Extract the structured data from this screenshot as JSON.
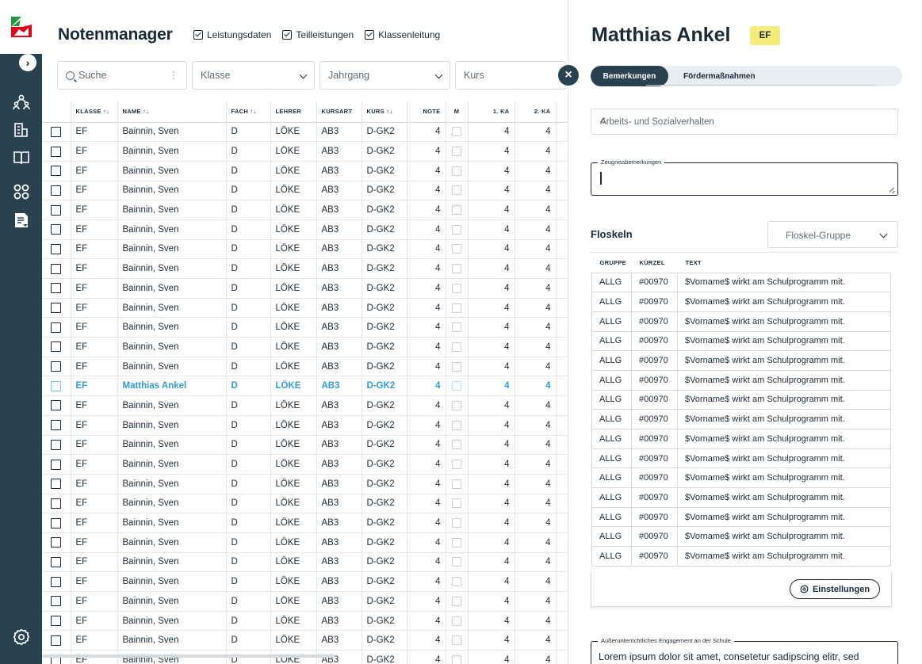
{
  "app": {
    "title": "Notenmanager"
  },
  "toggles": [
    "Leistungsdaten",
    "Teilleistungen",
    "Klassenleitung"
  ],
  "filters": {
    "search_placeholder": "Suche",
    "klasse": "Klasse",
    "jahrgang": "Jahrgang",
    "kurs": "Kurs"
  },
  "table": {
    "headers": [
      "KLASSE ↑↓",
      "NAME ↑↓",
      "FACH ↑↓",
      "LEHRER",
      "KURSART",
      "KURS ↑↓",
      "NOTE",
      "M",
      "1. KA",
      "2. KA"
    ],
    "rows": [
      [
        "EF",
        "Bainnin, Sven",
        "D",
        "LÖKE",
        "AB3",
        "D-GK2",
        "4",
        "4",
        "4"
      ],
      [
        "EF",
        "Bainnin, Sven",
        "D",
        "LÖKE",
        "AB3",
        "D-GK2",
        "4",
        "4",
        "4"
      ],
      [
        "EF",
        "Bainnin, Sven",
        "D",
        "LÖKE",
        "AB3",
        "D-GK2",
        "4",
        "4",
        "4"
      ],
      [
        "EF",
        "Bainnin, Sven",
        "D",
        "LÖKE",
        "AB3",
        "D-GK2",
        "4",
        "4",
        "4"
      ],
      [
        "EF",
        "Bainnin, Sven",
        "D",
        "LÖKE",
        "AB3",
        "D-GK2",
        "4",
        "4",
        "4"
      ],
      [
        "EF",
        "Bainnin, Sven",
        "D",
        "LÖKE",
        "AB3",
        "D-GK2",
        "4",
        "4",
        "4"
      ],
      [
        "EF",
        "Bainnin, Sven",
        "D",
        "LÖKE",
        "AB3",
        "D-GK2",
        "4",
        "4",
        "4"
      ],
      [
        "EF",
        "Bainnin, Sven",
        "D",
        "LÖKE",
        "AB3",
        "D-GK2",
        "4",
        "4",
        "4"
      ],
      [
        "EF",
        "Bainnin, Sven",
        "D",
        "LÖKE",
        "AB3",
        "D-GK2",
        "4",
        "4",
        "4"
      ],
      [
        "EF",
        "Bainnin, Sven",
        "D",
        "LÖKE",
        "AB3",
        "D-GK2",
        "4",
        "4",
        "4"
      ],
      [
        "EF",
        "Bainnin, Sven",
        "D",
        "LÖKE",
        "AB3",
        "D-GK2",
        "4",
        "4",
        "4"
      ],
      [
        "EF",
        "Bainnin, Sven",
        "D",
        "LÖKE",
        "AB3",
        "D-GK2",
        "4",
        "4",
        "4"
      ],
      [
        "EF",
        "Bainnin, Sven",
        "D",
        "LÖKE",
        "AB3",
        "D-GK2",
        "4",
        "4",
        "4"
      ],
      [
        "EF",
        "Matthias Ankel",
        "D",
        "LÖKE",
        "AB3",
        "D-GK2",
        "4",
        "4",
        "4"
      ],
      [
        "EF",
        "Bainnin, Sven",
        "D",
        "LÖKE",
        "AB3",
        "D-GK2",
        "4",
        "4",
        "4"
      ],
      [
        "EF",
        "Bainnin, Sven",
        "D",
        "LÖKE",
        "AB3",
        "D-GK2",
        "4",
        "4",
        "4"
      ],
      [
        "EF",
        "Bainnin, Sven",
        "D",
        "LÖKE",
        "AB3",
        "D-GK2",
        "4",
        "4",
        "4"
      ],
      [
        "EF",
        "Bainnin, Sven",
        "D",
        "LÖKE",
        "AB3",
        "D-GK2",
        "4",
        "4",
        "4"
      ],
      [
        "EF",
        "Bainnin, Sven",
        "D",
        "LÖKE",
        "AB3",
        "D-GK2",
        "4",
        "4",
        "4"
      ],
      [
        "EF",
        "Bainnin, Sven",
        "D",
        "LÖKE",
        "AB3",
        "D-GK2",
        "4",
        "4",
        "4"
      ],
      [
        "EF",
        "Bainnin, Sven",
        "D",
        "LÖKE",
        "AB3",
        "D-GK2",
        "4",
        "4",
        "4"
      ],
      [
        "EF",
        "Bainnin, Sven",
        "D",
        "LÖKE",
        "AB3",
        "D-GK2",
        "4",
        "4",
        "4"
      ],
      [
        "EF",
        "Bainnin, Sven",
        "D",
        "LÖKE",
        "AB3",
        "D-GK2",
        "4",
        "4",
        "4"
      ],
      [
        "EF",
        "Bainnin, Sven",
        "D",
        "LÖKE",
        "AB3",
        "D-GK2",
        "4",
        "4",
        "4"
      ],
      [
        "EF",
        "Bainnin, Sven",
        "D",
        "LÖKE",
        "AB3",
        "D-GK2",
        "4",
        "4",
        "4"
      ],
      [
        "EF",
        "Bainnin, Sven",
        "D",
        "LÖKE",
        "AB3",
        "D-GK2",
        "4",
        "4",
        "4"
      ],
      [
        "EF",
        "Bainnin, Sven",
        "D",
        "LÖKE",
        "AB3",
        "D-GK2",
        "4",
        "4",
        "4"
      ],
      [
        "EF",
        "Bainnin, Sven",
        "D",
        "LÖKE",
        "AB3",
        "D-GK2",
        "4",
        "4",
        "4"
      ]
    ],
    "selected_row": 13
  },
  "panel": {
    "student_name": "Matthias Ankel",
    "class_badge": "EF",
    "tabs": [
      "Bemerkungen",
      "Fördermaßnahmen"
    ],
    "arbeits_placeholder": "Arbeits- und Sozialverhalten",
    "zeugnis_label": "Zeugnissbemerkungen",
    "floskeln_title": "Floskeln",
    "floskel_group_placeholder": "Floskel-Gruppe",
    "floskel_headers": [
      "GRUPPE",
      "KÜRZEL",
      "TEXT"
    ],
    "floskel_rows": [
      [
        "ALLG",
        "#00970",
        "$Vorname$ wirkt am Schulprogramm mit."
      ],
      [
        "ALLG",
        "#00970",
        "$Vorname$ wirkt am Schulprogramm mit."
      ],
      [
        "ALLG",
        "#00970",
        "$Vorname$ wirkt am Schulprogramm mit."
      ],
      [
        "ALLG",
        "#00970",
        "$Vorname$ wirkt am Schulprogramm mit."
      ],
      [
        "ALLG",
        "#00970",
        "$Vorname$ wirkt am Schulprogramm mit."
      ],
      [
        "ALLG",
        "#00970",
        "$Vorname$ wirkt am Schulprogramm mit."
      ],
      [
        "ALLG",
        "#00970",
        "$Vorname$ wirkt am Schulprogramm mit."
      ],
      [
        "ALLG",
        "#00970",
        "$Vorname$ wirkt am Schulprogramm mit."
      ],
      [
        "ALLG",
        "#00970",
        "$Vorname$ wirkt am Schulprogramm mit."
      ],
      [
        "ALLG",
        "#00970",
        "$Vorname$ wirkt am Schulprogramm mit."
      ],
      [
        "ALLG",
        "#00970",
        "$Vorname$ wirkt am Schulprogramm mit."
      ],
      [
        "ALLG",
        "#00970",
        "$Vorname$ wirkt am Schulprogramm mit."
      ],
      [
        "ALLG",
        "#00970",
        "$Vorname$ wirkt am Schulprogramm mit."
      ],
      [
        "ALLG",
        "#00970",
        "$Vorname$ wirkt am Schulprogramm mit."
      ],
      [
        "ALLG",
        "#00970",
        "$Vorname$ wirkt am Schulprogramm mit."
      ]
    ],
    "settings_button": "Einstellungen",
    "engagement_label": "Außerunterrichtliches Engagement an der Schule",
    "engagement_value": "Lorem ipsum dolor sit amet, consetetur sadipscing elitr, sed"
  },
  "colors": {
    "sidebar": "#2a4250",
    "highlight": "#329cd5",
    "badge": "#f6ec7b"
  },
  "icons": {
    "sidebar": [
      "users-icon",
      "building-icon",
      "book-icon",
      "groups-icon",
      "grades-icon",
      "settings-icon"
    ]
  }
}
